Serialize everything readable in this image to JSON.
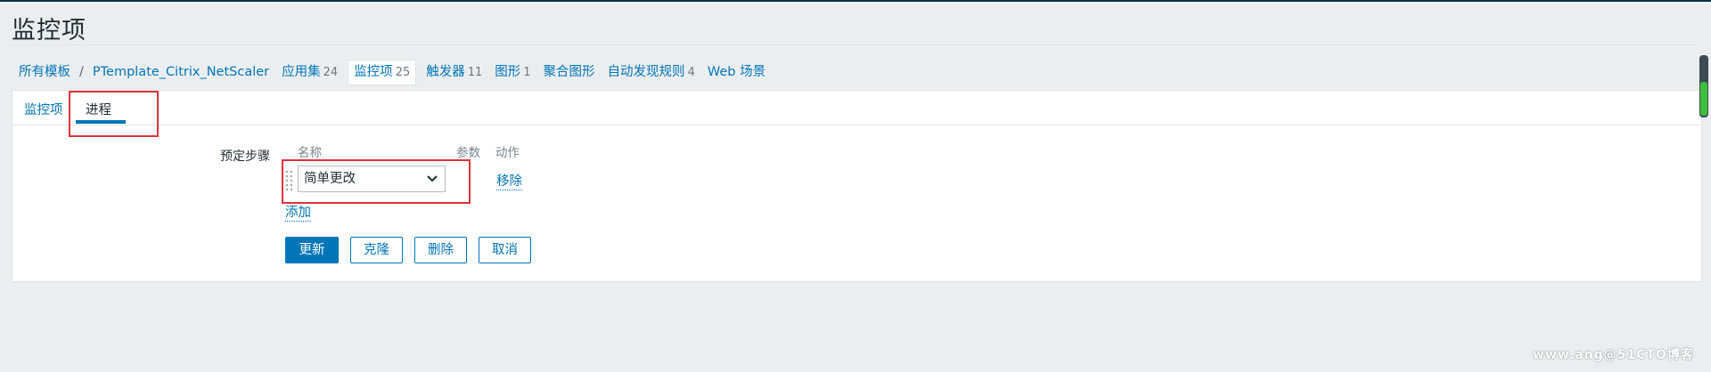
{
  "page": {
    "title": "监控项"
  },
  "breadcrumbs": [
    {
      "label": "所有模板"
    },
    {
      "label": "/"
    },
    {
      "label": "PTemplate_Citrix_NetScaler"
    },
    {
      "label": "应用集",
      "count": "24"
    },
    {
      "label": "监控项",
      "count": "25"
    },
    {
      "label": "触发器",
      "count": "11"
    },
    {
      "label": "图形",
      "count": "1"
    },
    {
      "label": "聚合图形"
    },
    {
      "label": "自动发现规则",
      "count": "4"
    },
    {
      "label": "Web 场景"
    }
  ],
  "tabs": [
    {
      "label": "监控项"
    },
    {
      "label": "进程"
    }
  ],
  "form": {
    "label": "预定步骤",
    "columns": {
      "name": "名称",
      "params": "参数",
      "action": "动作"
    },
    "step": {
      "selected": "简单更改",
      "remove": "移除"
    },
    "add": "添加"
  },
  "buttons": {
    "update": "更新",
    "clone": "克隆",
    "delete": "删除",
    "cancel": "取消"
  },
  "watermark": "www.ang@51CTO博客",
  "colors": {
    "link": "#0275b8",
    "highlight": "#e0323a",
    "background": "#ebeef0"
  }
}
